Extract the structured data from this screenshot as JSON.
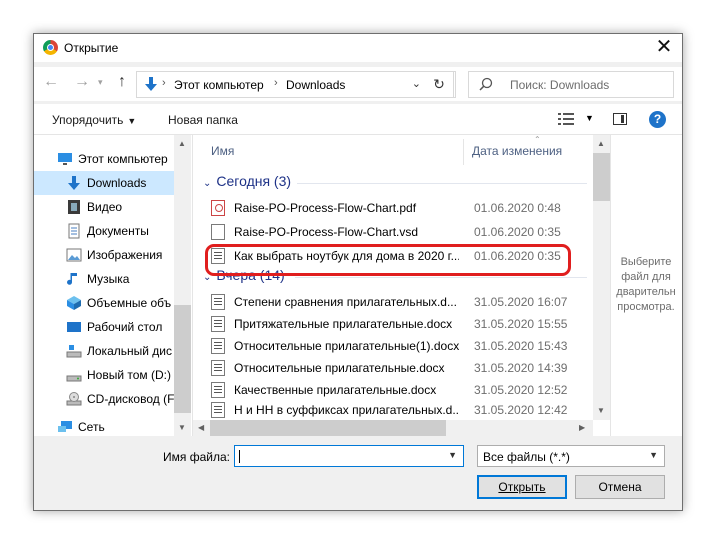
{
  "window": {
    "title": "Открытие"
  },
  "address": {
    "path": [
      "Этот компьютер",
      "Downloads"
    ]
  },
  "search": {
    "placeholder": "Поиск: Downloads"
  },
  "toolbar": {
    "organize": "Упорядочить",
    "new_folder": "Новая папка"
  },
  "nav": {
    "items": [
      {
        "label": "Этот компьютер",
        "icon": "pc-icon",
        "selected": false
      },
      {
        "label": "Downloads",
        "icon": "download-folder-icon",
        "selected": true
      },
      {
        "label": "Видео",
        "icon": "video-folder-icon",
        "selected": false
      },
      {
        "label": "Документы",
        "icon": "documents-folder-icon",
        "selected": false
      },
      {
        "label": "Изображения",
        "icon": "pictures-folder-icon",
        "selected": false
      },
      {
        "label": "Музыка",
        "icon": "music-folder-icon",
        "selected": false
      },
      {
        "label": "Объемные объ",
        "icon": "3d-objects-icon",
        "selected": false
      },
      {
        "label": "Рабочий стол",
        "icon": "desktop-icon",
        "selected": false
      },
      {
        "label": "Локальный дис",
        "icon": "drive-icon",
        "selected": false
      },
      {
        "label": "Новый том (D:)",
        "icon": "drive-icon",
        "selected": false
      },
      {
        "label": "CD-дисковод (F",
        "icon": "cd-drive-icon",
        "selected": false
      },
      {
        "label": "Сеть",
        "icon": "network-icon",
        "selected": false
      }
    ]
  },
  "files": {
    "columns": {
      "name": "Имя",
      "date": "Дата изменения"
    },
    "groups": [
      {
        "label": "Сегодня (3)",
        "rows": [
          {
            "name": "Raise-PO-Process-Flow-Chart.pdf",
            "date": "01.06.2020 0:48",
            "icon": "pdf-file-icon"
          },
          {
            "name": "Raise-PO-Process-Flow-Chart.vsd",
            "date": "01.06.2020 0:35",
            "icon": "file-icon"
          },
          {
            "name": "Как выбрать ноутбук для дома в 2020 г...",
            "date": "01.06.2020 0:35",
            "icon": "doc-file-icon"
          }
        ]
      },
      {
        "label": "Вчера (14)",
        "rows": [
          {
            "name": "Степени сравнения прилагательных.d...",
            "date": "31.05.2020 16:07",
            "icon": "doc-file-icon"
          },
          {
            "name": "Притяжательные прилагательные.docx",
            "date": "31.05.2020 15:55",
            "icon": "doc-file-icon"
          },
          {
            "name": "Относительные прилагательные(1).docx",
            "date": "31.05.2020 15:43",
            "icon": "doc-file-icon"
          },
          {
            "name": "Относительные прилагательные.docx",
            "date": "31.05.2020 14:39",
            "icon": "doc-file-icon"
          },
          {
            "name": "Качественные прилагательные.docx",
            "date": "31.05.2020 12:52",
            "icon": "doc-file-icon"
          },
          {
            "name": "Н и НН в суффиксах прилагательных.d...",
            "date": "31.05.2020 12:42",
            "icon": "doc-file-icon"
          }
        ]
      }
    ]
  },
  "preview": {
    "text": "Выберите файл для дварительн просмотра."
  },
  "bottom": {
    "filename_label": "Имя файла:",
    "filename_value": "",
    "filetype": "Все файлы (*.*)",
    "open_label": "Открыть",
    "cancel_label": "Отмена"
  },
  "colors": {
    "accent": "#0078d7",
    "highlight_annotation": "#e01e1e",
    "selection": "#cce8ff"
  }
}
